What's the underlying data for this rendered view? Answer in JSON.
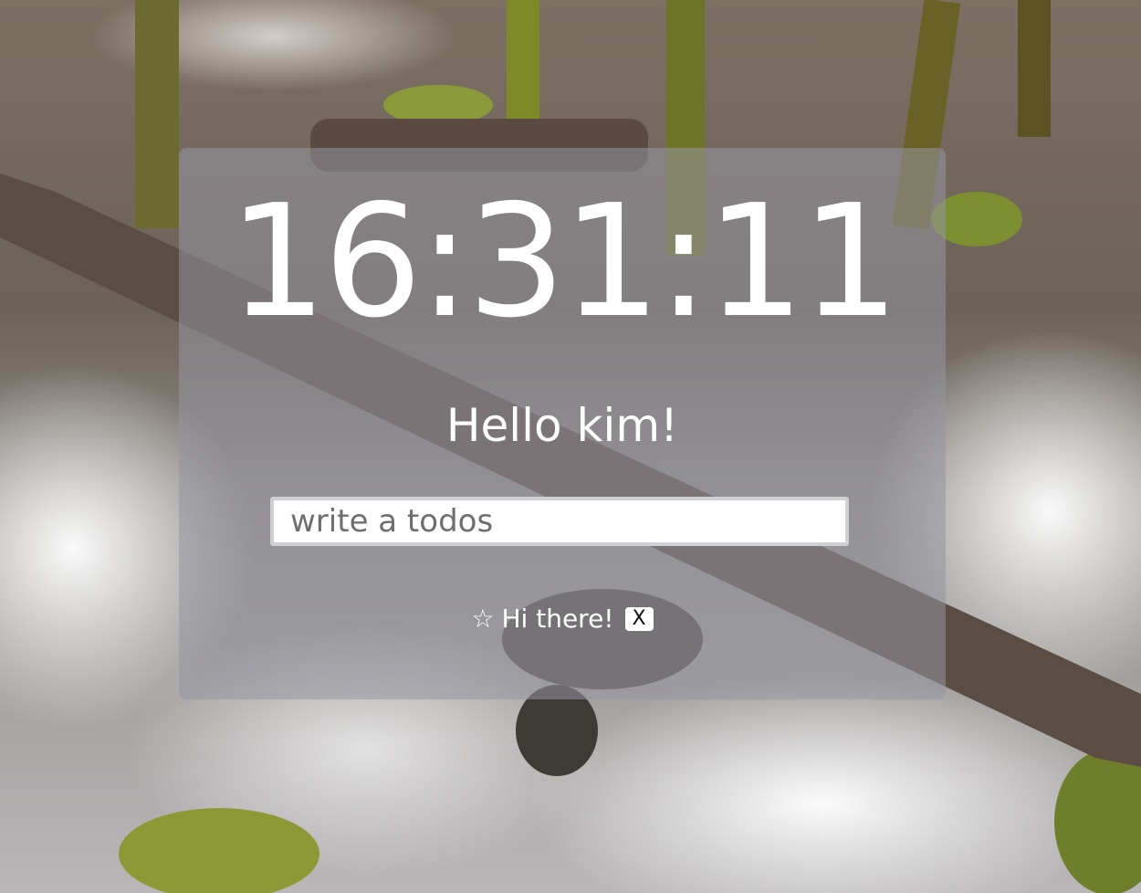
{
  "clock": {
    "time": "16:31:11"
  },
  "greeting": {
    "text": "Hello kim!"
  },
  "todo_form": {
    "placeholder": "write a todos",
    "value": ""
  },
  "todos": [
    {
      "icon": "☆",
      "text": "Hi there!",
      "delete_label": "X"
    }
  ]
}
